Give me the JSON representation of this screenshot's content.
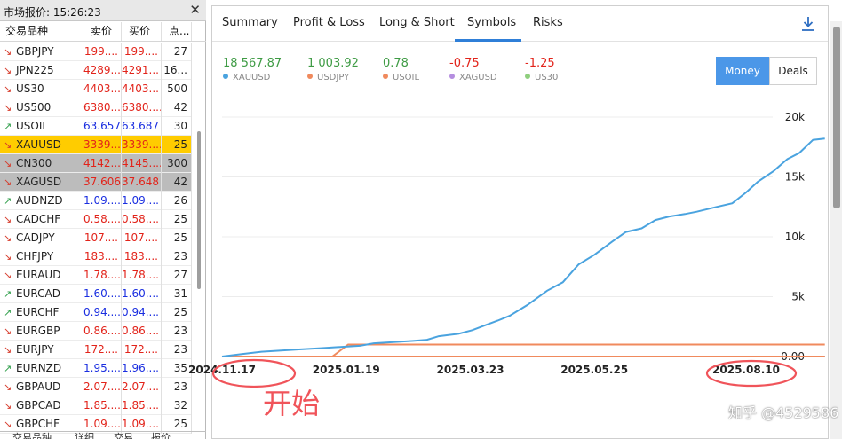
{
  "market_watch": {
    "title": "市场报价: 15:26:23",
    "close": "✕",
    "headers": {
      "symbol": "交易品种",
      "bid": "卖价",
      "ask": "买价",
      "spread": "点..."
    },
    "rows": [
      {
        "symbol": "GBPJPY",
        "dir": "down",
        "bid": "199....",
        "ask": "199....",
        "spread": "27",
        "color": "red"
      },
      {
        "symbol": "JPN225",
        "dir": "down",
        "bid": "4289...",
        "ask": "4291...",
        "spread": "16...",
        "color": "red"
      },
      {
        "symbol": "US30",
        "dir": "down",
        "bid": "4403...",
        "ask": "4403...",
        "spread": "500",
        "color": "red"
      },
      {
        "symbol": "US500",
        "dir": "down",
        "bid": "6380....",
        "ask": "6380....",
        "spread": "42",
        "color": "red"
      },
      {
        "symbol": "USOIL",
        "dir": "up",
        "bid": "63.657",
        "ask": "63.687",
        "spread": "30",
        "color": "blue"
      },
      {
        "symbol": "XAUUSD",
        "dir": "down",
        "bid": "3339....",
        "ask": "3339....",
        "spread": "25",
        "color": "red",
        "highlight": "yellow"
      },
      {
        "symbol": "CN300",
        "dir": "down",
        "bid": "4142....",
        "ask": "4145....",
        "spread": "300",
        "color": "red",
        "highlight": "gray"
      },
      {
        "symbol": "XAGUSD",
        "dir": "down",
        "bid": "37.606",
        "ask": "37.648",
        "spread": "42",
        "color": "red",
        "highlight": "gray"
      },
      {
        "symbol": "AUDNZD",
        "dir": "up",
        "bid": "1.09....",
        "ask": "1.09....",
        "spread": "26",
        "color": "blue"
      },
      {
        "symbol": "CADCHF",
        "dir": "down",
        "bid": "0.58....",
        "ask": "0.58....",
        "spread": "25",
        "color": "red"
      },
      {
        "symbol": "CADJPY",
        "dir": "down",
        "bid": "107....",
        "ask": "107....",
        "spread": "25",
        "color": "red"
      },
      {
        "symbol": "CHFJPY",
        "dir": "down",
        "bid": "183....",
        "ask": "183....",
        "spread": "23",
        "color": "red"
      },
      {
        "symbol": "EURAUD",
        "dir": "down",
        "bid": "1.78....",
        "ask": "1.78....",
        "spread": "27",
        "color": "red"
      },
      {
        "symbol": "EURCAD",
        "dir": "up",
        "bid": "1.60....",
        "ask": "1.60....",
        "spread": "31",
        "color": "blue"
      },
      {
        "symbol": "EURCHF",
        "dir": "up",
        "bid": "0.94....",
        "ask": "0.94....",
        "spread": "25",
        "color": "blue"
      },
      {
        "symbol": "EURGBP",
        "dir": "down",
        "bid": "0.86....",
        "ask": "0.86....",
        "spread": "23",
        "color": "red"
      },
      {
        "symbol": "EURJPY",
        "dir": "down",
        "bid": "172....",
        "ask": "172....",
        "spread": "23",
        "color": "red"
      },
      {
        "symbol": "EURNZD",
        "dir": "up",
        "bid": "1.95....",
        "ask": "1.96....",
        "spread": "35",
        "color": "blue"
      },
      {
        "symbol": "GBPAUD",
        "dir": "down",
        "bid": "2.07....",
        "ask": "2.07....",
        "spread": "23",
        "color": "red"
      },
      {
        "symbol": "GBPCAD",
        "dir": "down",
        "bid": "1.85....",
        "ask": "1.85....",
        "spread": "32",
        "color": "red"
      },
      {
        "symbol": "GBPCHF",
        "dir": "down",
        "bid": "1.09....",
        "ask": "1.09....",
        "spread": "25",
        "color": "red"
      }
    ],
    "bottom_tabs": [
      "交易品种",
      "详细",
      "交易",
      "报价"
    ]
  },
  "report": {
    "tabs": [
      "Summary",
      "Profit & Loss",
      "Long & Short",
      "Symbols",
      "Risks"
    ],
    "active_tab": "Symbols",
    "stats": [
      {
        "value": "18 567.87",
        "name": "XAUUSD",
        "value_color": "#3e9b44",
        "dot_color": "#4aa3df"
      },
      {
        "value": "1 003.92",
        "name": "USDJPY",
        "value_color": "#3e9b44",
        "dot_color": "#f08a5d"
      },
      {
        "value": "0.78",
        "name": "USOIL",
        "value_color": "#3e9b44",
        "dot_color": "#f08a5d"
      },
      {
        "value": "-0.75",
        "name": "XAGUSD",
        "value_color": "#e2231a",
        "dot_color": "#b58ee0"
      },
      {
        "value": "-1.25",
        "name": "US30",
        "value_color": "#e2231a",
        "dot_color": "#8fcf7e"
      }
    ],
    "money_label": "Money",
    "deals_label": "Deals"
  },
  "chart_data": {
    "type": "line",
    "y_ticks": [
      "20k",
      "15k",
      "10k",
      "5k",
      "0.00"
    ],
    "y_tick_values": [
      20000,
      15000,
      10000,
      5000,
      0
    ],
    "ylim": [
      0,
      20000
    ],
    "x_ticks": [
      "2024.11.17",
      "2025.01.19",
      "2025.03.23",
      "2025.05.25",
      "2025.08.10"
    ],
    "x_tick_dates": [
      "2024-11-17",
      "2025-01-19",
      "2025-03-23",
      "2025-05-25",
      "2025-08-10"
    ],
    "series": [
      {
        "name": "XAUUSD",
        "color": "#4aa3df",
        "points": [
          [
            "2024-11-17",
            0
          ],
          [
            "2024-11-27",
            200
          ],
          [
            "2024-12-07",
            400
          ],
          [
            "2024-12-17",
            500
          ],
          [
            "2024-12-27",
            600
          ],
          [
            "2025-01-06",
            700
          ],
          [
            "2025-01-16",
            800
          ],
          [
            "2025-01-26",
            900
          ],
          [
            "2025-02-02",
            1100
          ],
          [
            "2025-02-12",
            1200
          ],
          [
            "2025-02-22",
            1300
          ],
          [
            "2025-03-01",
            1400
          ],
          [
            "2025-03-07",
            1700
          ],
          [
            "2025-03-17",
            1900
          ],
          [
            "2025-03-24",
            2200
          ],
          [
            "2025-04-01",
            2700
          ],
          [
            "2025-04-06",
            3000
          ],
          [
            "2025-04-12",
            3400
          ],
          [
            "2025-04-21",
            4300
          ],
          [
            "2025-05-01",
            5500
          ],
          [
            "2025-05-09",
            6200
          ],
          [
            "2025-05-17",
            7700
          ],
          [
            "2025-05-25",
            8500
          ],
          [
            "2025-06-03",
            9600
          ],
          [
            "2025-06-10",
            10400
          ],
          [
            "2025-06-18",
            10700
          ],
          [
            "2025-06-25",
            11400
          ],
          [
            "2025-07-02",
            11700
          ],
          [
            "2025-07-10",
            11900
          ],
          [
            "2025-07-16",
            12100
          ],
          [
            "2025-07-26",
            12500
          ],
          [
            "2025-08-03",
            12800
          ],
          [
            "2025-08-10",
            13700
          ],
          [
            "2025-08-16",
            14600
          ],
          [
            "2025-08-24",
            15500
          ],
          [
            "2025-08-31",
            16500
          ],
          [
            "2025-09-06",
            17000
          ],
          [
            "2025-09-13",
            18100
          ],
          [
            "2025-09-19",
            18200
          ]
        ]
      },
      {
        "name": "USDJPY",
        "color": "#f08a5d",
        "points": [
          [
            "2024-11-17",
            0
          ],
          [
            "2025-01-12",
            0
          ],
          [
            "2025-01-20",
            1000
          ],
          [
            "2025-09-19",
            1000
          ]
        ]
      },
      {
        "name": "USOIL",
        "color": "#f08a5d",
        "points": [
          [
            "2024-11-17",
            0
          ],
          [
            "2025-09-19",
            0
          ]
        ]
      },
      {
        "name": "XAGUSD",
        "color": "#b58ee0",
        "points": [
          [
            "2024-11-17",
            0
          ],
          [
            "2025-09-19",
            0
          ]
        ]
      },
      {
        "name": "US30",
        "color": "#2bb5a8",
        "points": [
          [
            "2024-11-17",
            0
          ],
          [
            "2025-09-19",
            0
          ]
        ]
      }
    ]
  },
  "annotation": {
    "text": "开始",
    "color": "#f0545a"
  },
  "watermark": "知乎 @4529586"
}
